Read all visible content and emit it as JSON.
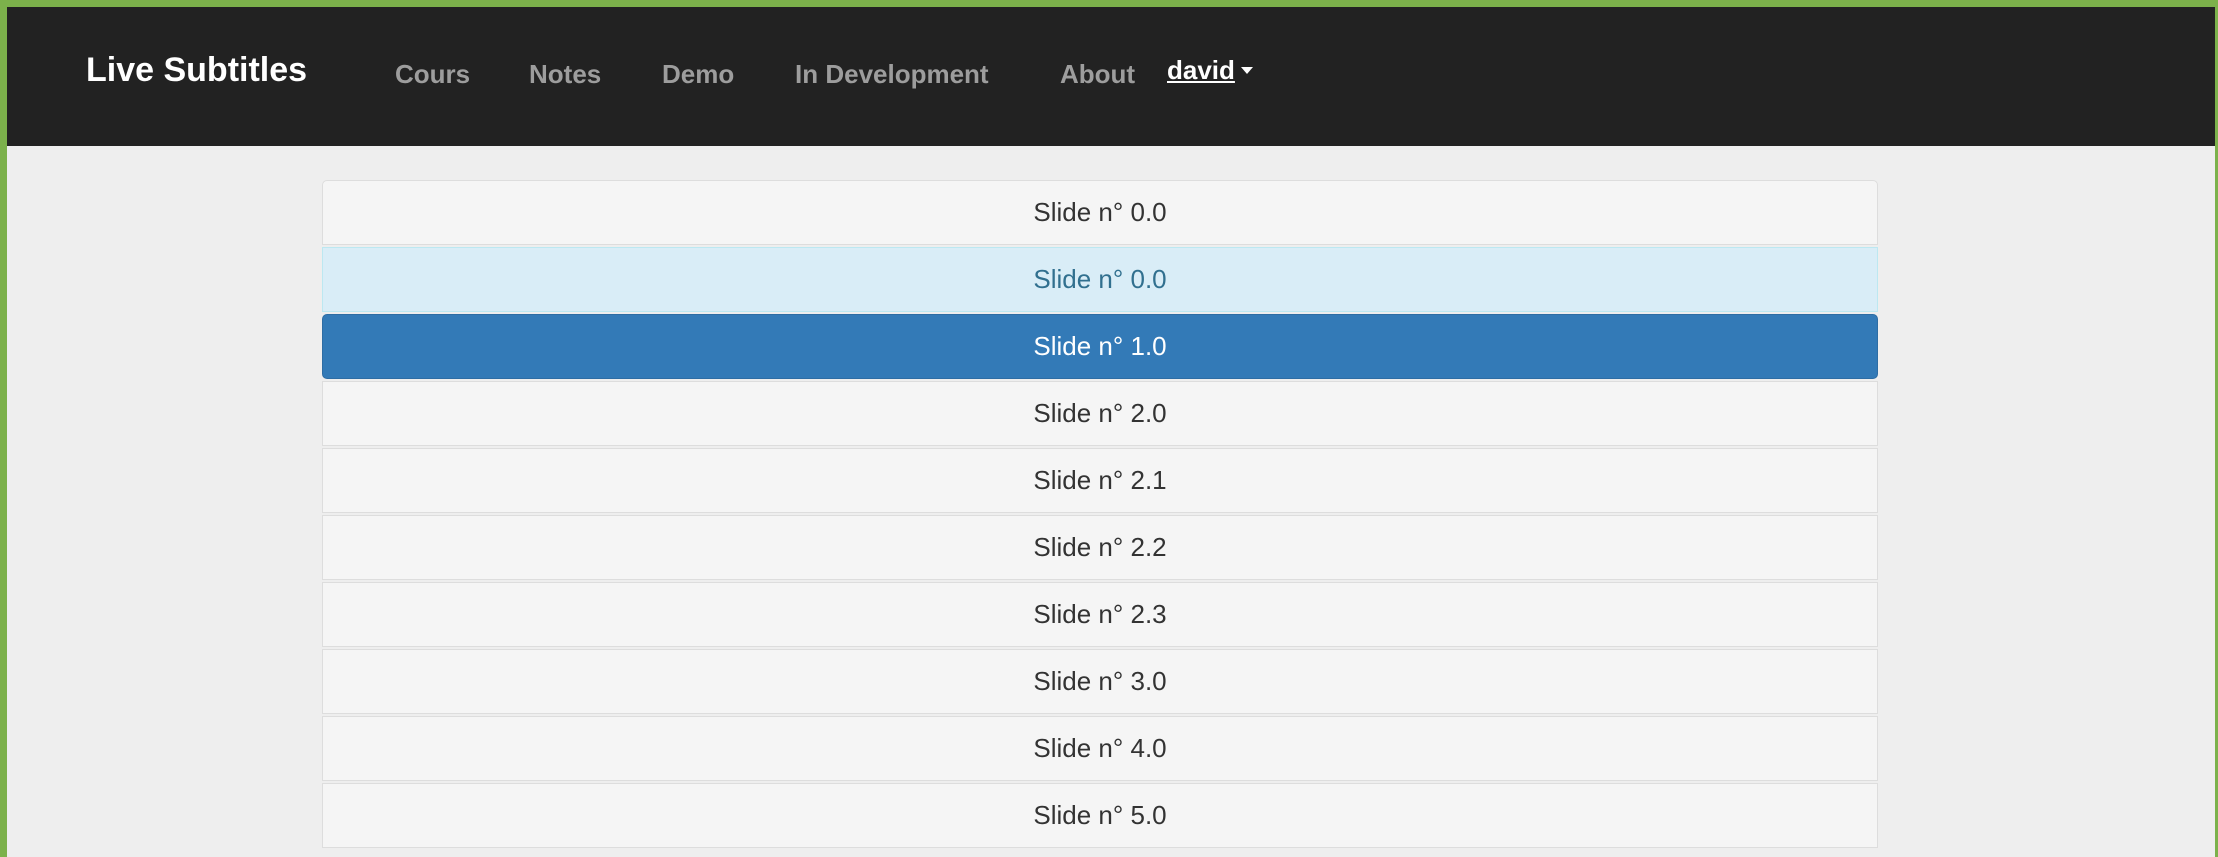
{
  "navbar": {
    "brand": "Live Subtitles",
    "links": [
      "Cours",
      "Notes",
      "Demo",
      "In Development",
      "About"
    ],
    "user": "david"
  },
  "slides": [
    {
      "label": "Slide n° 0.0",
      "state": "default"
    },
    {
      "label": "Slide n° 0.0",
      "state": "info"
    },
    {
      "label": "Slide n° 1.0",
      "state": "active"
    },
    {
      "label": "Slide n° 2.0",
      "state": "default"
    },
    {
      "label": "Slide n° 2.1",
      "state": "default"
    },
    {
      "label": "Slide n° 2.2",
      "state": "default"
    },
    {
      "label": "Slide n° 2.3",
      "state": "default"
    },
    {
      "label": "Slide n° 3.0",
      "state": "default"
    },
    {
      "label": "Slide n° 4.0",
      "state": "default"
    },
    {
      "label": "Slide n° 5.0",
      "state": "default"
    }
  ],
  "colors": {
    "outer_border": "#7cb14b",
    "navbar_bg": "#222222",
    "active_bg": "#337ab7",
    "info_bg": "#d9edf7"
  }
}
